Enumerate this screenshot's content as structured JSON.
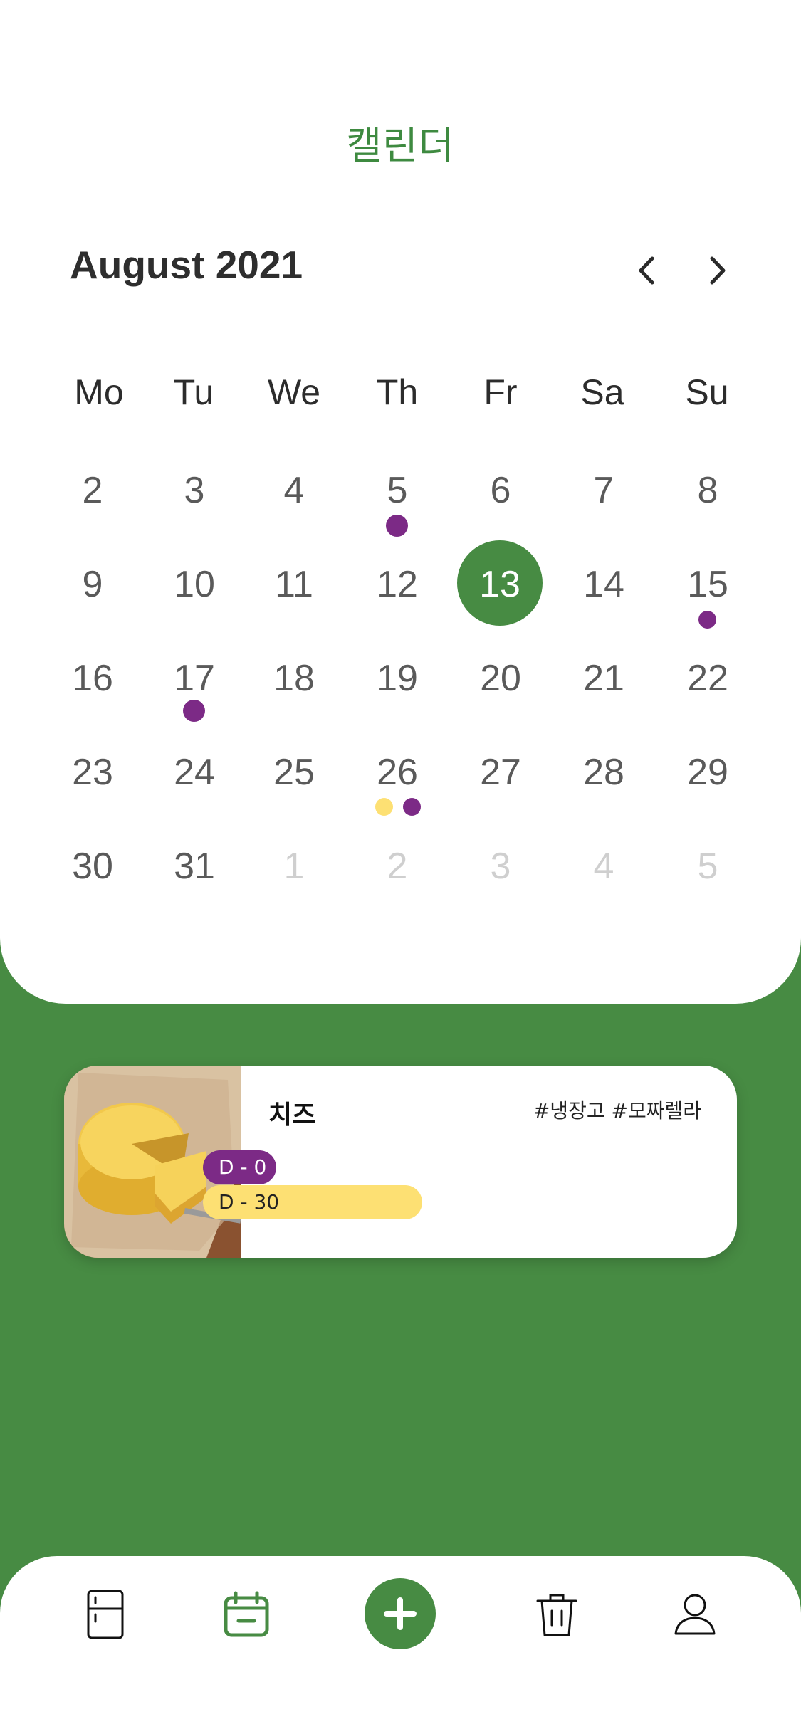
{
  "page": {
    "title": "캘린더"
  },
  "calendar": {
    "month_label": "August 2021",
    "weekdays": [
      "Mo",
      "Tu",
      "We",
      "Th",
      "Fr",
      "Sa",
      "Su"
    ],
    "weeks": [
      [
        "2",
        "3",
        "4",
        "5",
        "6",
        "7",
        "8"
      ],
      [
        "9",
        "10",
        "11",
        "12",
        "13",
        "14",
        "15"
      ],
      [
        "16",
        "17",
        "18",
        "19",
        "20",
        "21",
        "22"
      ],
      [
        "23",
        "24",
        "25",
        "26",
        "27",
        "28",
        "29"
      ],
      [
        "30",
        "31",
        "1",
        "2",
        "3",
        "4",
        "5"
      ]
    ],
    "selected_day": "13",
    "event_markers": [
      {
        "day": "5",
        "colors": [
          "purple"
        ]
      },
      {
        "day": "15",
        "colors": [
          "purple"
        ]
      },
      {
        "day": "17",
        "colors": [
          "purple"
        ]
      },
      {
        "day": "26",
        "colors": [
          "yellow",
          "purple"
        ]
      }
    ]
  },
  "food_card": {
    "name": "치즈",
    "tags": "#냉장고 #모짜렐라",
    "badges": [
      {
        "label": "D - 0",
        "color": "purple"
      },
      {
        "label": "D - 30",
        "color": "yellow"
      }
    ]
  },
  "bottom_nav": {
    "items": [
      "fridge-icon",
      "calendar-icon",
      "add-icon",
      "trash-icon",
      "user-icon"
    ],
    "active": "calendar-icon"
  },
  "colors": {
    "primary_green": "#478b43",
    "event_purple": "#7c2a86",
    "event_yellow": "#fde073",
    "muted_day": "#cfcfcf"
  }
}
